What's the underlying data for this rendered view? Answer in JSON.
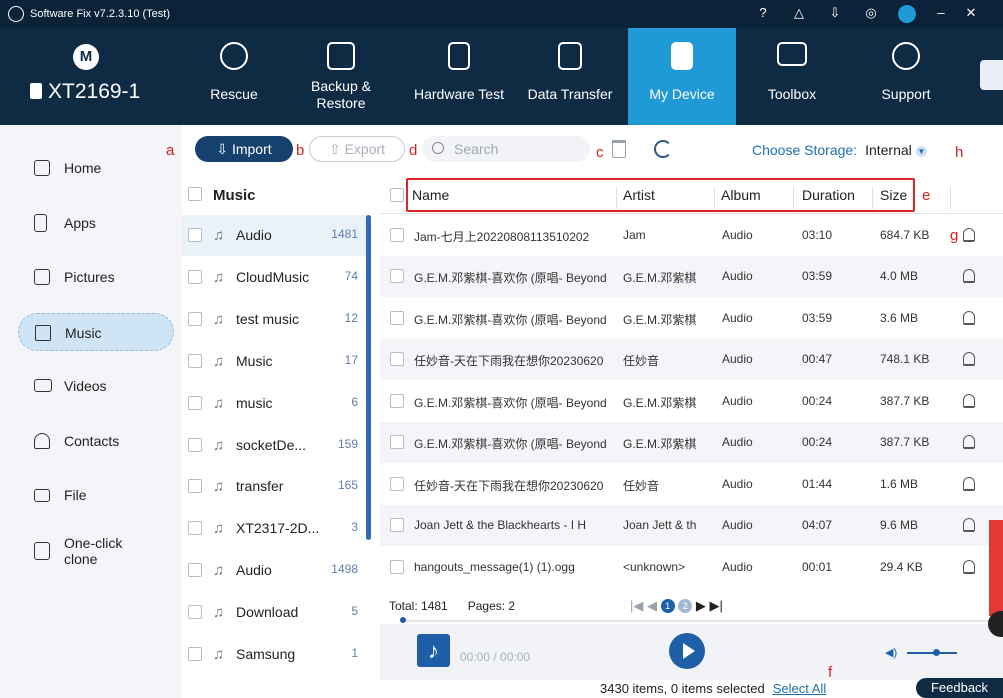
{
  "titlebar": {
    "title": "Software Fix v7.2.3.10 (Test)"
  },
  "brand": {
    "logo": "M",
    "device": "XT2169-1"
  },
  "nav": [
    {
      "label": "Rescue"
    },
    {
      "label": "Backup &\nRestore"
    },
    {
      "label": "Hardware Test"
    },
    {
      "label": "Data Transfer"
    },
    {
      "label": "My Device"
    },
    {
      "label": "Toolbox"
    },
    {
      "label": "Support"
    }
  ],
  "sidebar": [
    {
      "label": "Home",
      "icon": "home-icon"
    },
    {
      "label": "Apps",
      "icon": "phone-icon"
    },
    {
      "label": "Pictures",
      "icon": "image-icon"
    },
    {
      "label": "Music",
      "icon": "music-icon"
    },
    {
      "label": "Videos",
      "icon": "video-icon"
    },
    {
      "label": "Contacts",
      "icon": "person-icon"
    },
    {
      "label": "File",
      "icon": "folder-icon"
    },
    {
      "label": "One-click clone",
      "icon": "clone-icon"
    }
  ],
  "toolbar": {
    "import": "Import",
    "export": "Export",
    "search_placeholder": "Search",
    "storage_label": "Choose Storage:",
    "storage_value": "Internal"
  },
  "annotations": {
    "a": "a",
    "b": "b",
    "c": "c",
    "d": "d",
    "e": "e",
    "f": "f",
    "g": "g",
    "h": "h"
  },
  "folders": {
    "title": "Music",
    "items": [
      {
        "name": "Audio",
        "count": "1481"
      },
      {
        "name": "CloudMusic",
        "count": "74"
      },
      {
        "name": "test music",
        "count": "12"
      },
      {
        "name": "Music",
        "count": "17"
      },
      {
        "name": "music",
        "count": "6"
      },
      {
        "name": "socketDe...",
        "count": "159"
      },
      {
        "name": "transfer",
        "count": "165"
      },
      {
        "name": "XT2317-2D...",
        "count": "3"
      },
      {
        "name": "Audio",
        "count": "1498"
      },
      {
        "name": "Download",
        "count": "5"
      },
      {
        "name": "Samsung",
        "count": "1"
      }
    ]
  },
  "table": {
    "columns": {
      "name": "Name",
      "artist": "Artist",
      "album": "Album",
      "duration": "Duration",
      "size": "Size"
    },
    "rows": [
      {
        "name": "Jam-七月上20220808113510202",
        "artist": "Jam",
        "album": "Audio",
        "duration": "03:10",
        "size": "684.7 KB"
      },
      {
        "name": "G.E.M.邓紫棋-喜欢你 (原唱- Beyond",
        "artist": "G.E.M.邓紫棋",
        "album": "Audio",
        "duration": "03:59",
        "size": "4.0 MB"
      },
      {
        "name": "G.E.M.邓紫棋-喜欢你 (原唱- Beyond",
        "artist": "G.E.M.邓紫棋",
        "album": "Audio",
        "duration": "03:59",
        "size": "3.6 MB"
      },
      {
        "name": "任妙音-天在下雨我在想你20230620",
        "artist": "任妙音",
        "album": "Audio",
        "duration": "00:47",
        "size": "748.1 KB"
      },
      {
        "name": "G.E.M.邓紫棋-喜欢你 (原唱- Beyond",
        "artist": "G.E.M.邓紫棋",
        "album": "Audio",
        "duration": "00:24",
        "size": "387.7 KB"
      },
      {
        "name": "G.E.M.邓紫棋-喜欢你 (原唱- Beyond",
        "artist": "G.E.M.邓紫棋",
        "album": "Audio",
        "duration": "00:24",
        "size": "387.7 KB"
      },
      {
        "name": "任妙音-天在下雨我在想你20230620",
        "artist": "任妙音",
        "album": "Audio",
        "duration": "01:44",
        "size": "1.6 MB"
      },
      {
        "name": "Joan Jett & the Blackhearts - I H",
        "artist": "Joan Jett & th",
        "album": "Audio",
        "duration": "04:07",
        "size": "9.6 MB"
      },
      {
        "name": "hangouts_message(1) (1).ogg",
        "artist": "<unknown>",
        "album": "Audio",
        "duration": "00:01",
        "size": "29.4 KB"
      }
    ]
  },
  "pagination": {
    "total": "Total: 1481",
    "pages": "Pages: 2",
    "page1": "1",
    "page2": "2"
  },
  "player": {
    "time": "00:00 / 00:00"
  },
  "status": {
    "summary": "3430 items, 0 items selected",
    "select_all": "Select All",
    "feedback": "Feedback"
  }
}
